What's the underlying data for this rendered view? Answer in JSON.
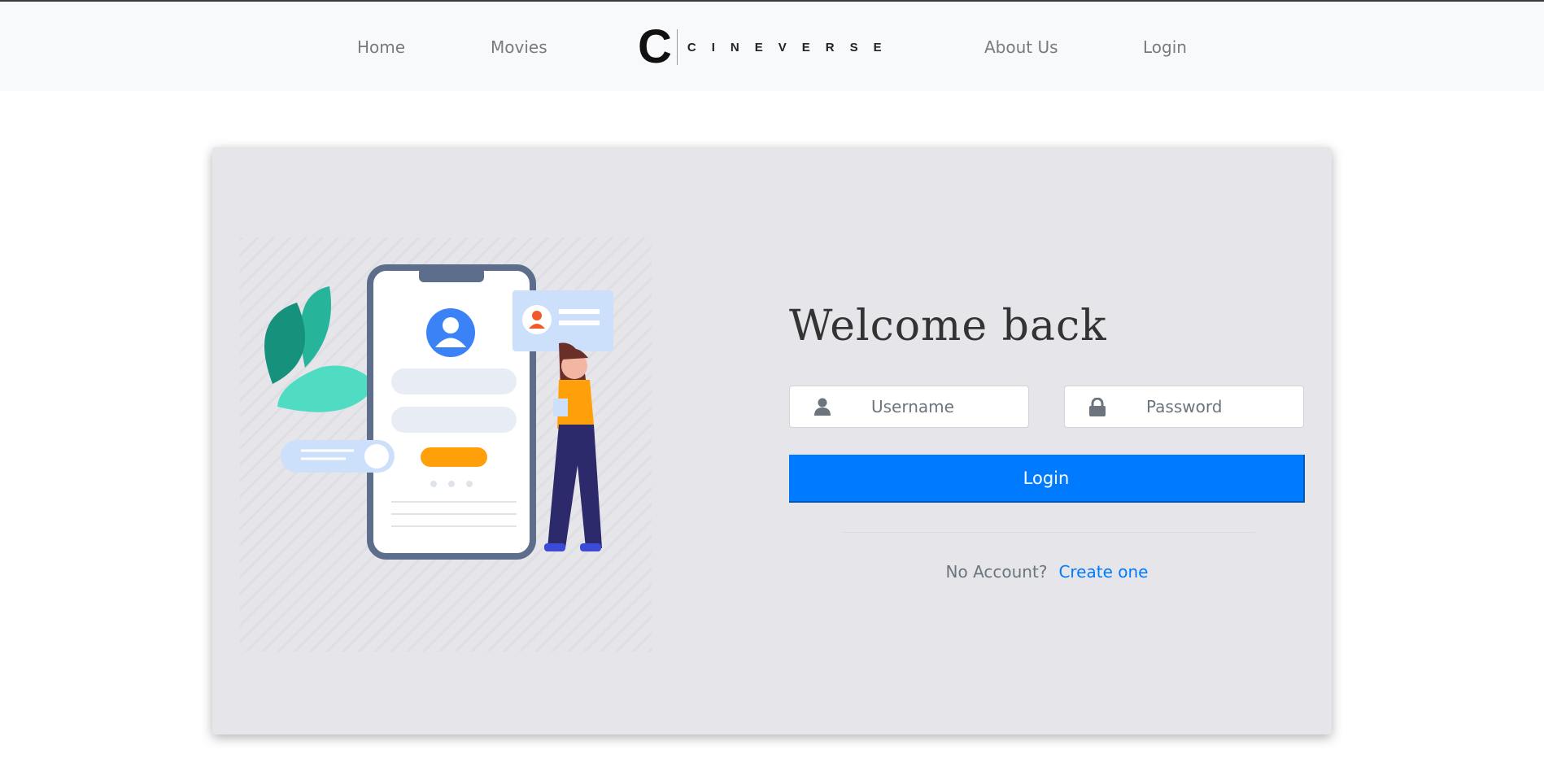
{
  "nav": {
    "home": "Home",
    "movies": "Movies",
    "logo_letter": "C",
    "logo_word": "CINEVERSE",
    "about": "About Us",
    "login": "Login"
  },
  "login": {
    "title": "Welcome back",
    "username_placeholder": "Username",
    "password_placeholder": "Password",
    "button": "Login",
    "no_account": "No Account?",
    "create": "Create one"
  },
  "colors": {
    "primary": "#007bff",
    "card": "#e5e5ea"
  }
}
